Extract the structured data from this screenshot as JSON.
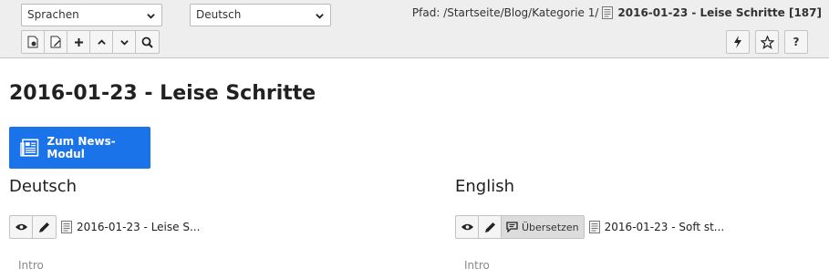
{
  "toolbar": {
    "language_select": {
      "value": "Sprachen"
    },
    "translation_select": {
      "value": "Deutsch"
    },
    "path_label": "Pfad: /Startseite/Blog/Kategorie 1/",
    "path_record": "2016-01-23 - Leise Schritte [187]",
    "help_label": "?"
  },
  "page": {
    "title": "2016-01-23 - Leise Schritte",
    "news_button_label": "Zum News-Modul"
  },
  "columns": [
    {
      "language": "Deutsch",
      "record_title": "2016-01-23 - Leise S...",
      "section_label": "Intro"
    },
    {
      "language": "English",
      "translate_label": "Übersetzen",
      "record_title": "2016-01-23 - Soft st...",
      "section_label": "Intro"
    }
  ],
  "colors": {
    "accent": "#1a73e8",
    "toolbar_bg": "#eeeeee"
  }
}
